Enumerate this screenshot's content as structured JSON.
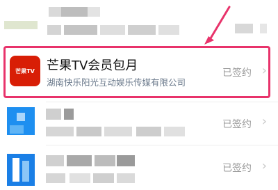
{
  "subscriptions": [
    {
      "id": "row-1",
      "obscured": true
    },
    {
      "id": "row-2",
      "icon_label": "芒果TV",
      "title": "芒果TV会员包月",
      "company": "湖南快乐阳光互动娱乐传媒有限公司",
      "status": "已签约",
      "highlighted": true
    },
    {
      "id": "row-3",
      "obscured": true,
      "status": "已签约"
    },
    {
      "id": "row-4",
      "obscured": true,
      "status": "已签约"
    }
  ],
  "colors": {
    "highlight": "#e8336b",
    "mango_icon_bg": "#d81e06",
    "status_text": "#9a9a9a",
    "company_text": "#6b7a8c"
  },
  "icons": {
    "chevron": "chevron-right-icon",
    "arrow": "annotation-arrow"
  }
}
